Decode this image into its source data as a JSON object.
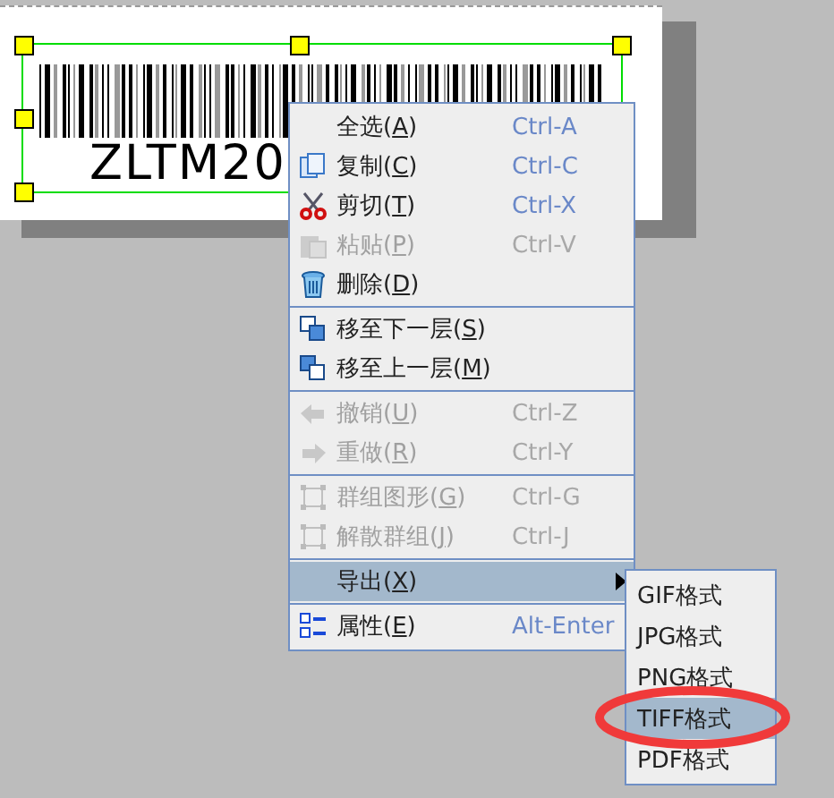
{
  "label": {
    "barcode_text": "ZLTM20",
    "selected": true
  },
  "context_menu": {
    "items": [
      {
        "kind": "item",
        "before": "全选(",
        "mnemonic": "A",
        "after": ")",
        "shortcut": "Ctrl-A",
        "disabled": false
      },
      {
        "kind": "item",
        "before": "复制(",
        "mnemonic": "C",
        "after": ")",
        "shortcut": "Ctrl-C",
        "disabled": false
      },
      {
        "kind": "item",
        "before": "剪切(",
        "mnemonic": "T",
        "after": ")",
        "shortcut": "Ctrl-X",
        "disabled": false
      },
      {
        "kind": "item",
        "before": "粘贴(",
        "mnemonic": "P",
        "after": ")",
        "shortcut": "Ctrl-V",
        "disabled": true
      },
      {
        "kind": "item",
        "before": "删除(",
        "mnemonic": "D",
        "after": ")",
        "disabled": false
      },
      {
        "kind": "separator"
      },
      {
        "kind": "item",
        "before": "移至下一层(",
        "mnemonic": "S",
        "after": ")",
        "disabled": false
      },
      {
        "kind": "item",
        "before": "移至上一层(",
        "mnemonic": "M",
        "after": ")",
        "disabled": false
      },
      {
        "kind": "separator"
      },
      {
        "kind": "item",
        "before": "撤销(",
        "mnemonic": "U",
        "after": ")",
        "shortcut": "Ctrl-Z",
        "disabled": true
      },
      {
        "kind": "item",
        "before": "重做(",
        "mnemonic": "R",
        "after": ")",
        "shortcut": "Ctrl-Y",
        "disabled": true
      },
      {
        "kind": "separator"
      },
      {
        "kind": "item",
        "before": "群组图形(",
        "mnemonic": "G",
        "after": ")",
        "shortcut": "Ctrl-G",
        "disabled": true
      },
      {
        "kind": "item",
        "before": "解散群组(",
        "mnemonic": "J",
        "after": ")",
        "shortcut": "Ctrl-J",
        "disabled": true
      },
      {
        "kind": "separator"
      },
      {
        "kind": "submenu",
        "before": "导出(",
        "mnemonic": "X",
        "after": ")",
        "selected": true,
        "disabled": false
      },
      {
        "kind": "separator"
      },
      {
        "kind": "item",
        "before": "属性(",
        "mnemonic": "E",
        "after": ")",
        "shortcut": "Alt-Enter",
        "disabled": false
      }
    ]
  },
  "submenu": {
    "items": [
      {
        "label": "GIF格式",
        "selected": false
      },
      {
        "label": "JPG格式",
        "selected": false
      },
      {
        "label": "PNG格式",
        "selected": false
      },
      {
        "label": "TIFF格式",
        "selected": true,
        "circled": true
      },
      {
        "label": "PDF格式",
        "selected": false
      }
    ]
  }
}
